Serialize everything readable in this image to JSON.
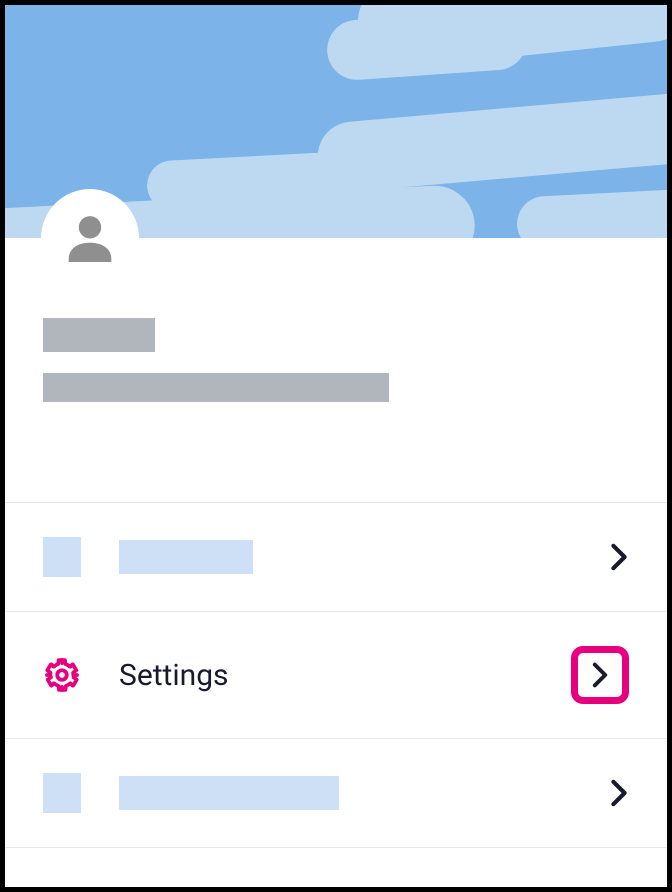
{
  "menu": {
    "settings": {
      "label": "Settings"
    }
  },
  "colors": {
    "accent": "#e6007e",
    "placeholder_gray": "#b0b6bc",
    "placeholder_blue": "#cde0f6",
    "sky": "#7cb3e8",
    "cloud": "#bdd9f2"
  }
}
